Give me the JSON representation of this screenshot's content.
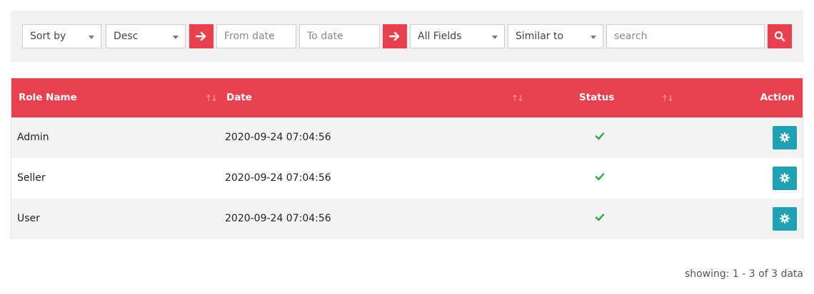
{
  "filters": {
    "sort_by": "Sort by",
    "order": "Desc",
    "from_date_placeholder": "From date",
    "to_date_placeholder": "To date",
    "fields": "All Fields",
    "match_mode": "Similar to",
    "search_placeholder": "search"
  },
  "table": {
    "columns": [
      "Role Name",
      "Date",
      "Status",
      "Action"
    ],
    "rows": [
      {
        "role": "Admin",
        "date": "2020-09-24 07:04:56",
        "status": "active"
      },
      {
        "role": "Seller",
        "date": "2020-09-24 07:04:56",
        "status": "active"
      },
      {
        "role": "User",
        "date": "2020-09-24 07:04:56",
        "status": "active"
      }
    ]
  },
  "footer": {
    "showing": "showing: 1 - 3 of 3 data"
  },
  "colors": {
    "accent": "#e8404f",
    "action_button": "#1ea2b4",
    "check": "#28a745",
    "row_alt": "#f3f3f3"
  },
  "icons": {
    "go": "arrow-right-icon",
    "search": "search-icon",
    "sort": "sort-icon",
    "status": "check-icon",
    "action": "gear-icon"
  }
}
